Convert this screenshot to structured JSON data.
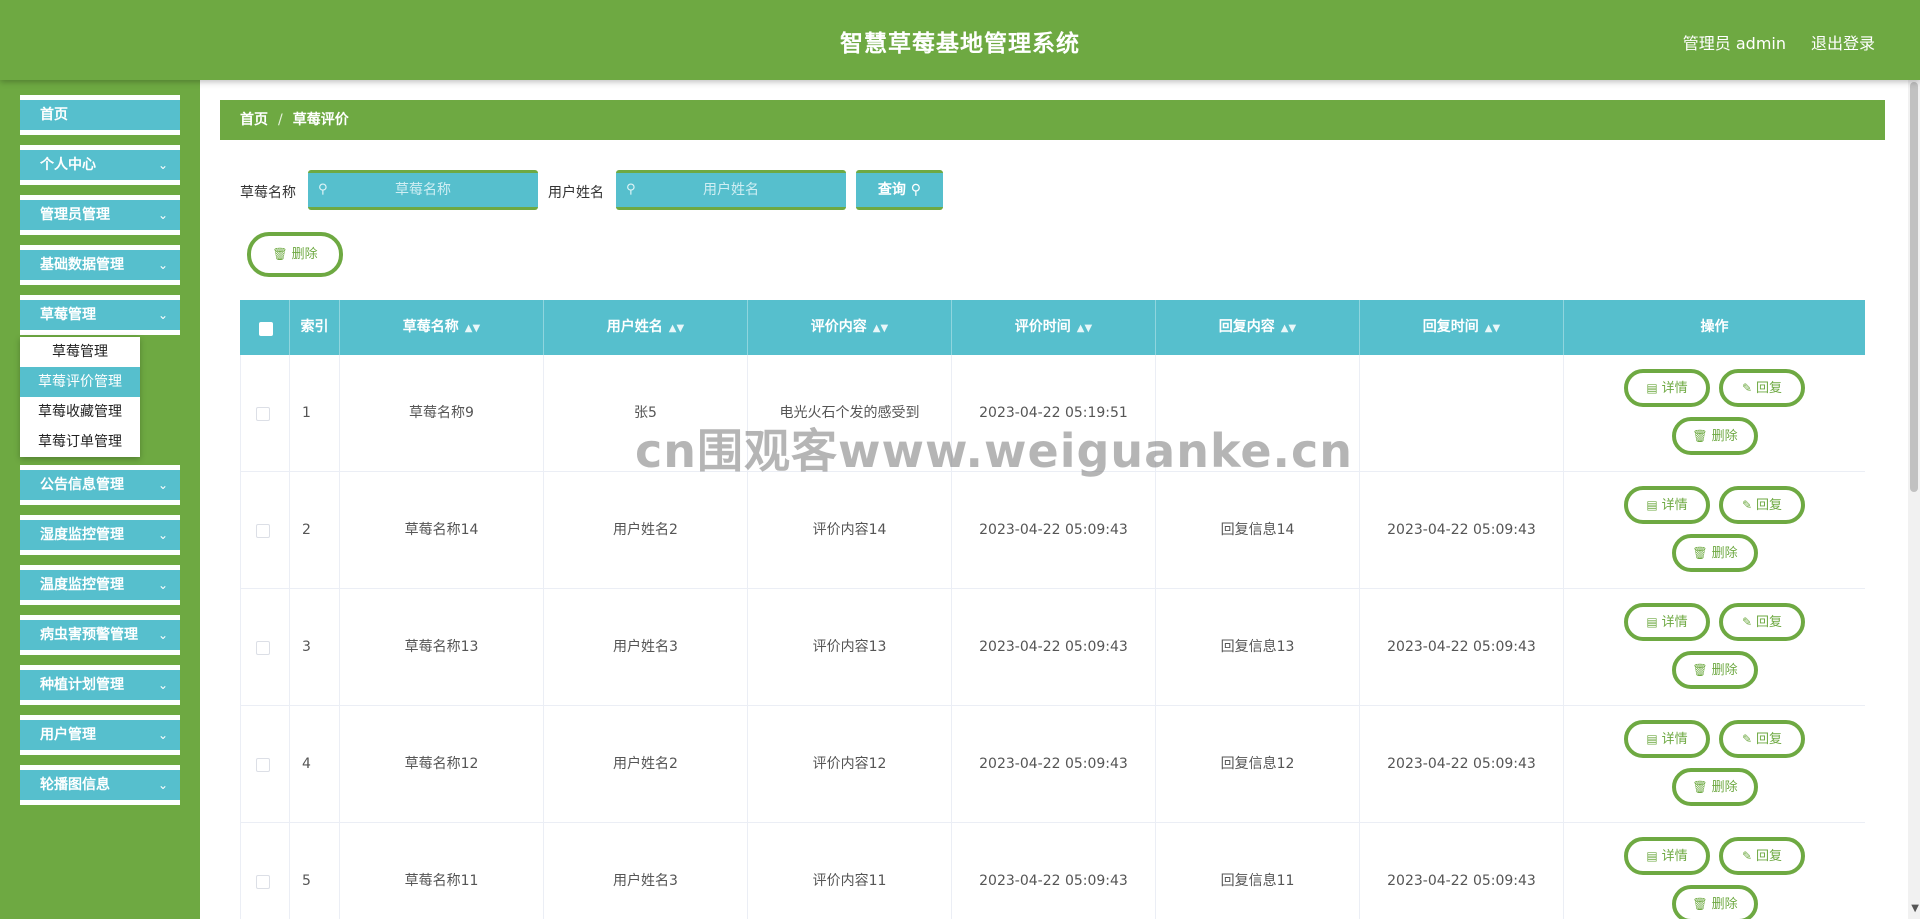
{
  "header": {
    "title": "智慧草莓基地管理系统",
    "user": "管理员 admin",
    "logout": "退出登录"
  },
  "sidebar": {
    "items": [
      {
        "label": "首页"
      },
      {
        "label": "个人中心"
      },
      {
        "label": "管理员管理"
      },
      {
        "label": "基础数据管理"
      },
      {
        "label": "草莓管理"
      },
      {
        "label": "公告信息管理"
      },
      {
        "label": "湿度监控管理"
      },
      {
        "label": "温度监控管理"
      },
      {
        "label": "病虫害预警管理"
      },
      {
        "label": "种植计划管理"
      },
      {
        "label": "用户管理"
      },
      {
        "label": "轮播图信息"
      }
    ],
    "submenu": [
      "草莓管理",
      "草莓评价管理",
      "草莓收藏管理",
      "草莓订单管理"
    ]
  },
  "breadcrumb": {
    "home": "首页",
    "current": "草莓评价"
  },
  "search": {
    "name_label": "草莓名称",
    "name_placeholder": "草莓名称",
    "user_label": "用户姓名",
    "user_placeholder": "用户姓名",
    "query_label": "查询"
  },
  "toolbar": {
    "delete_label": "删除"
  },
  "table": {
    "headers": [
      "索引",
      "草莓名称",
      "用户姓名",
      "评价内容",
      "评价时间",
      "回复内容",
      "回复时间",
      "操作"
    ],
    "rows": [
      {
        "index": "1",
        "name": "草莓名称9",
        "user": "张5",
        "content": "电光火石个发的感受到",
        "time": "2023-04-22 05:19:51",
        "reply": "",
        "reply_time": ""
      },
      {
        "index": "2",
        "name": "草莓名称14",
        "user": "用户姓名2",
        "content": "评价内容14",
        "time": "2023-04-22 05:09:43",
        "reply": "回复信息14",
        "reply_time": "2023-04-22 05:09:43"
      },
      {
        "index": "3",
        "name": "草莓名称13",
        "user": "用户姓名3",
        "content": "评价内容13",
        "time": "2023-04-22 05:09:43",
        "reply": "回复信息13",
        "reply_time": "2023-04-22 05:09:43"
      },
      {
        "index": "4",
        "name": "草莓名称12",
        "user": "用户姓名2",
        "content": "评价内容12",
        "time": "2023-04-22 05:09:43",
        "reply": "回复信息12",
        "reply_time": "2023-04-22 05:09:43"
      },
      {
        "index": "5",
        "name": "草莓名称11",
        "user": "用户姓名3",
        "content": "评价内容11",
        "time": "2023-04-22 05:09:43",
        "reply": "回复信息11",
        "reply_time": "2023-04-22 05:09:43"
      }
    ],
    "actions": {
      "detail": "详情",
      "reply": "回复",
      "delete": "删除"
    }
  },
  "watermark": "cn围观客www.weiguanke.cn",
  "icons": {
    "search": "search-icon",
    "delete": "trash-icon",
    "detail": "document-icon",
    "reply": "edit-icon",
    "sort": "sort-icon",
    "chevron": "chevron-down-icon"
  },
  "colors": {
    "primary_green": "#6ea942",
    "accent_cyan": "#56bfcd"
  }
}
